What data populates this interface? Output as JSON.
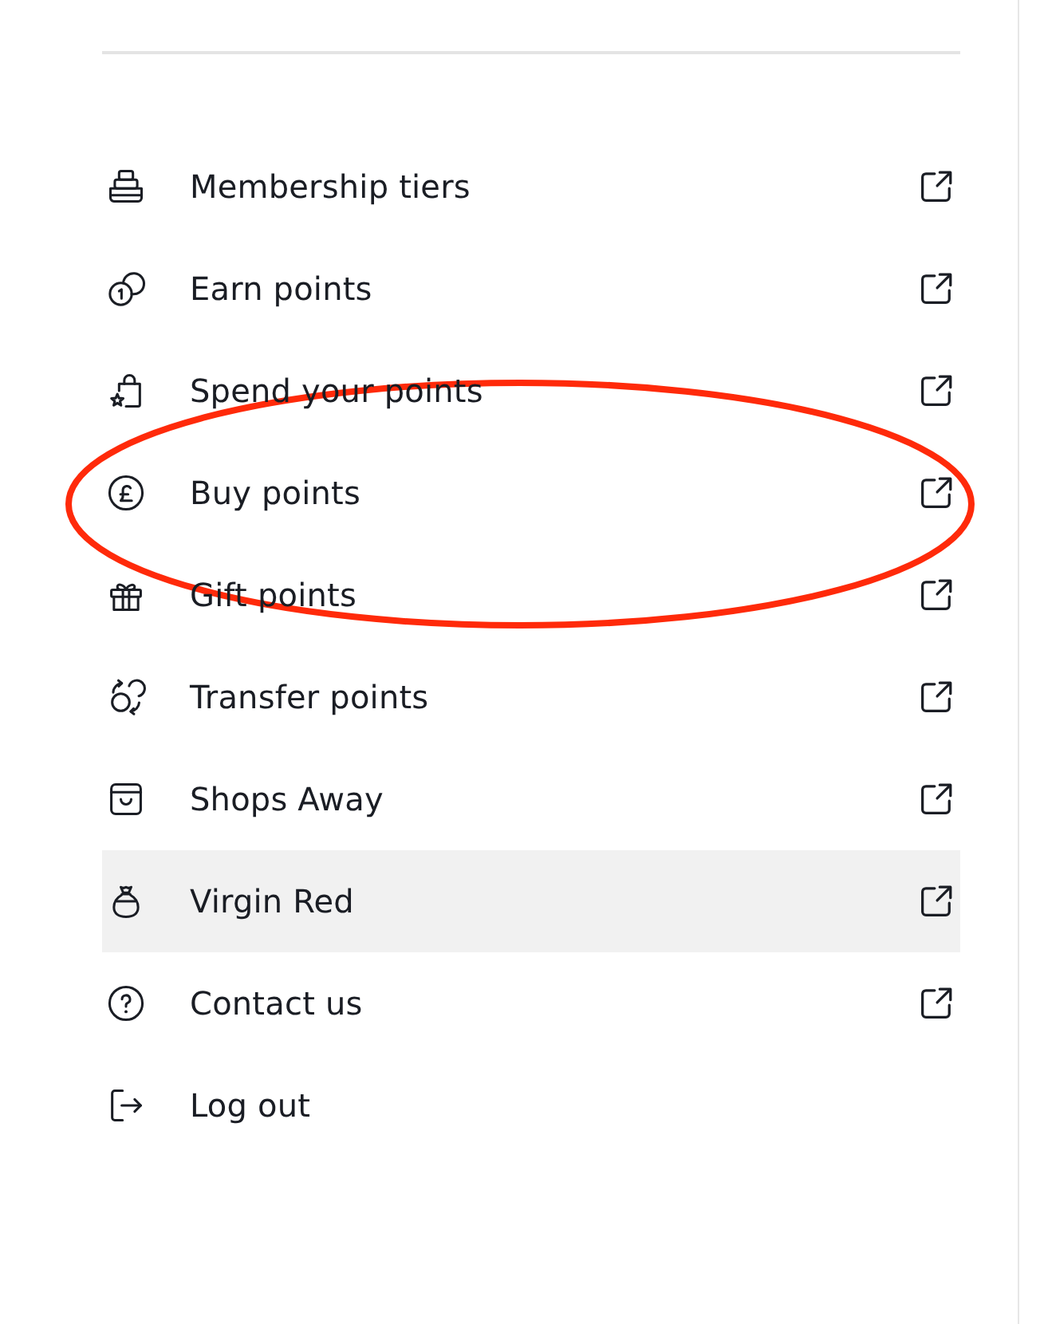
{
  "menu": {
    "items": [
      {
        "label": "Membership tiers",
        "external": true,
        "selected": false,
        "circled": false
      },
      {
        "label": "Earn points",
        "external": true,
        "selected": false,
        "circled": false
      },
      {
        "label": "Spend your points",
        "external": true,
        "selected": false,
        "circled": false
      },
      {
        "label": "Buy points",
        "external": true,
        "selected": false,
        "circled": true
      },
      {
        "label": "Gift points",
        "external": true,
        "selected": false,
        "circled": false
      },
      {
        "label": "Transfer points",
        "external": true,
        "selected": false,
        "circled": false
      },
      {
        "label": "Shops Away",
        "external": true,
        "selected": false,
        "circled": false
      },
      {
        "label": "Virgin Red",
        "external": true,
        "selected": true,
        "circled": false
      },
      {
        "label": "Contact us",
        "external": true,
        "selected": false,
        "circled": false
      },
      {
        "label": "Log out",
        "external": false,
        "selected": false,
        "circled": false
      }
    ]
  }
}
